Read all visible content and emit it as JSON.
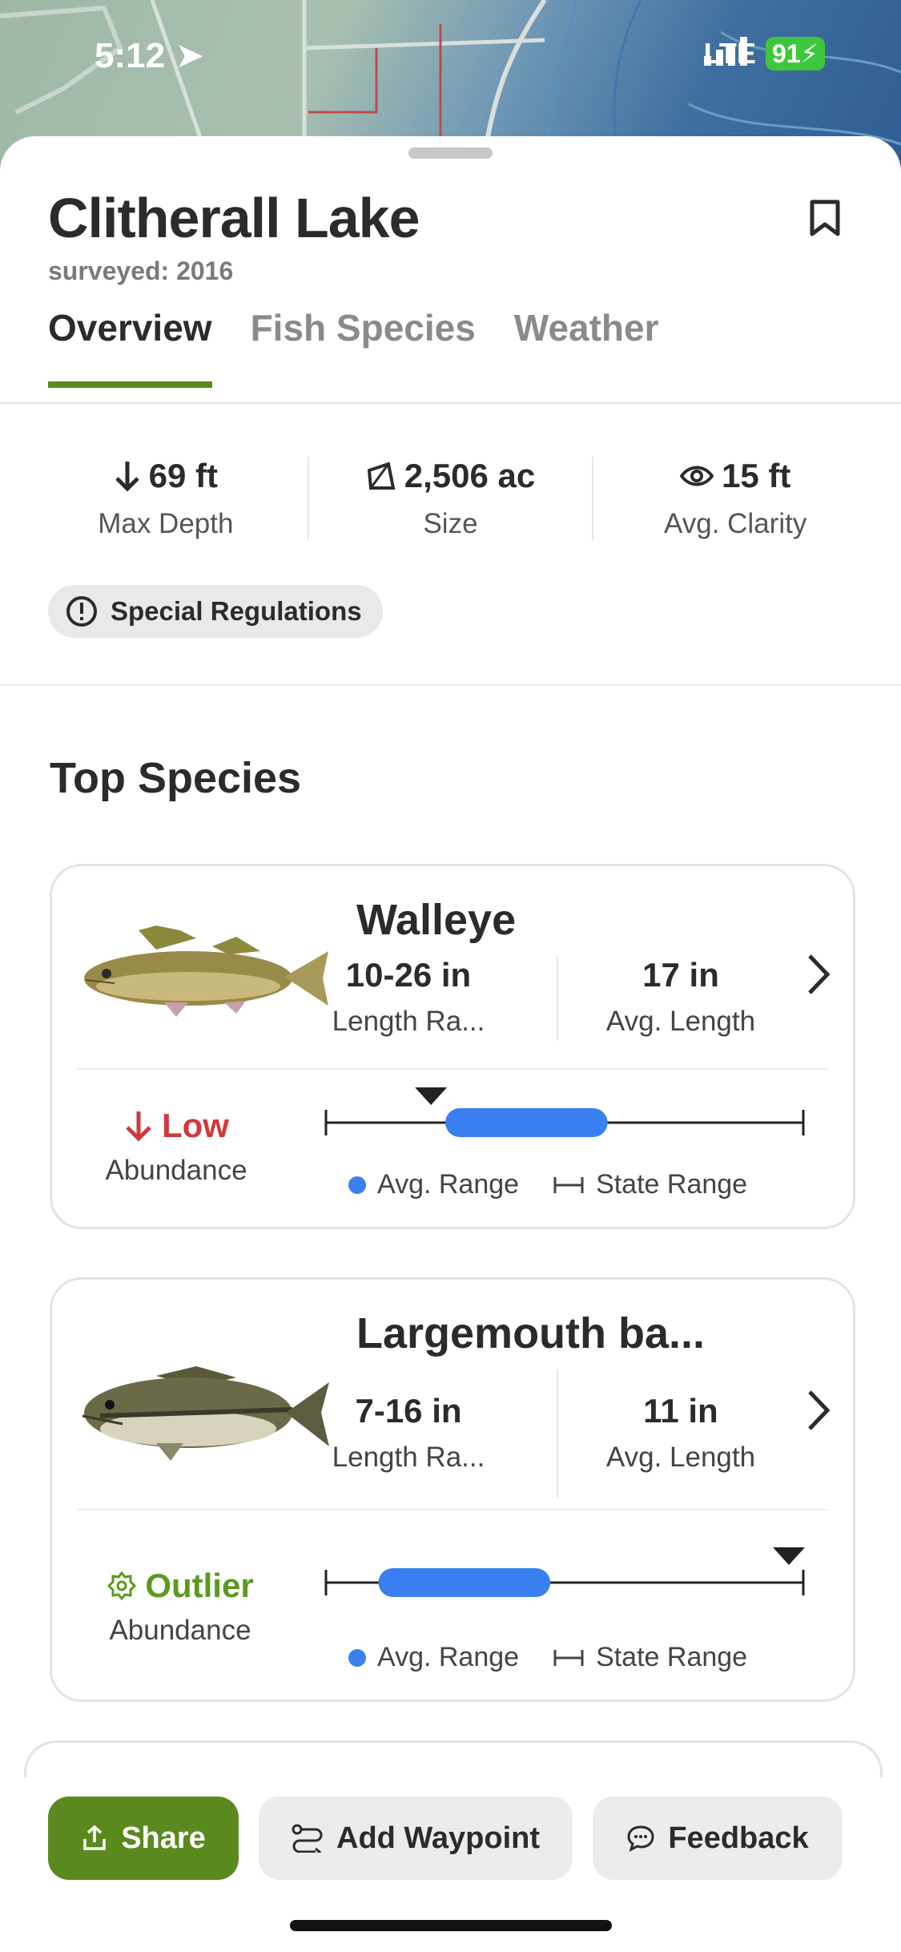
{
  "status_bar": {
    "time": "5:12",
    "network": "LTE",
    "battery": "91"
  },
  "lake": {
    "name": "Clitherall Lake",
    "surveyed": "surveyed: 2016"
  },
  "tabs": [
    {
      "label": "Overview",
      "active": true
    },
    {
      "label": "Fish Species",
      "active": false
    },
    {
      "label": "Weather",
      "active": false
    }
  ],
  "stats": [
    {
      "icon": "arrow-down-icon",
      "value": "69 ft",
      "label": "Max Depth"
    },
    {
      "icon": "area-icon",
      "value": "2,506 ac",
      "label": "Size"
    },
    {
      "icon": "eye-icon",
      "value": "15 ft",
      "label": "Avg. Clarity"
    }
  ],
  "special_regulations": "Special Regulations",
  "section_title": "Top Species",
  "species": [
    {
      "name": "Walleye",
      "length_range": "10-26 in",
      "length_range_label": "Length Ra...",
      "avg_length": "17 in",
      "avg_length_label": "Avg. Length",
      "abundance": "Low",
      "abundance_label": "Abundance",
      "abundance_color": "#d0393b",
      "avg_range_fraction": [
        0.25,
        0.59
      ],
      "marker_fraction": 0.22
    },
    {
      "name": "Largemouth ba...",
      "length_range": "7-16 in",
      "length_range_label": "Length Ra...",
      "avg_length": "11 in",
      "avg_length_label": "Avg. Length",
      "abundance": "Outlier",
      "abundance_label": "Abundance",
      "abundance_color": "#5a9a1e",
      "avg_range_fraction": [
        0.11,
        0.47
      ],
      "marker_fraction": 1.0
    }
  ],
  "legend": {
    "avg_range": "Avg. Range",
    "state_range": "State Range"
  },
  "buttons": {
    "share": "Share",
    "add_waypoint": "Add Waypoint",
    "feedback": "Feedback"
  },
  "colors": {
    "accent": "#5a8a1e",
    "range_blue": "#3a7ff0",
    "low_red": "#d0393b",
    "outlier_green": "#5a9a1e"
  }
}
